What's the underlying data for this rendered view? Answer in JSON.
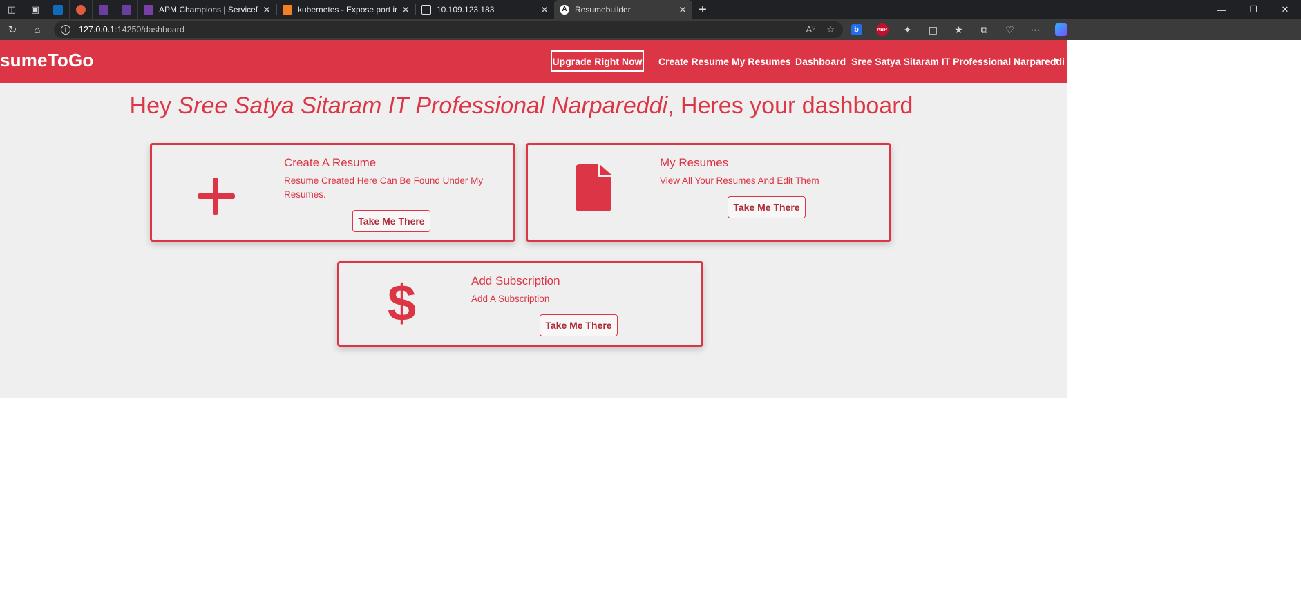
{
  "browser": {
    "tabs": [
      {
        "title": "APM Champions | ServicePortal",
        "favicon_color": "#9b59b6"
      },
      {
        "title": "kubernetes - Expose port in mini",
        "favicon_color": "#f48024"
      },
      {
        "title": "10.109.123.183",
        "favicon_color": "#e8e8e8"
      },
      {
        "title": "Resumebuilder",
        "favicon_color": "#ffffff",
        "active": true
      }
    ],
    "address": {
      "host": "127.0.0.1",
      "path": ":14250/dashboard"
    }
  },
  "navbar": {
    "brand": "sumeToGo",
    "upgrade": "Upgrade Right Now",
    "links": {
      "create_resume": "Create Resume",
      "my_resumes": "My Resumes",
      "dashboard": "Dashboard",
      "user": "Sree Satya Sitaram IT Professional Narpareddi"
    }
  },
  "heading": {
    "prefix": "Hey ",
    "name": "Sree Satya Sitaram IT Professional Narpareddi",
    "suffix": ", Heres your dashboard"
  },
  "cards": {
    "create": {
      "title": "Create A Resume",
      "text": "Resume Created Here Can Be Found Under My Resumes.",
      "button": "Take Me There",
      "icon": "plus-icon"
    },
    "resumes": {
      "title": "My Resumes",
      "text": "View All Your Resumes And Edit Them",
      "button": "Take Me There",
      "icon": "file-icon"
    },
    "subscription": {
      "title": "Add Subscription",
      "text": "Add A Subscription",
      "button": "Take Me There",
      "icon": "dollar-icon"
    }
  },
  "colors": {
    "accent": "#dc3545",
    "page_bg": "#efefef"
  }
}
